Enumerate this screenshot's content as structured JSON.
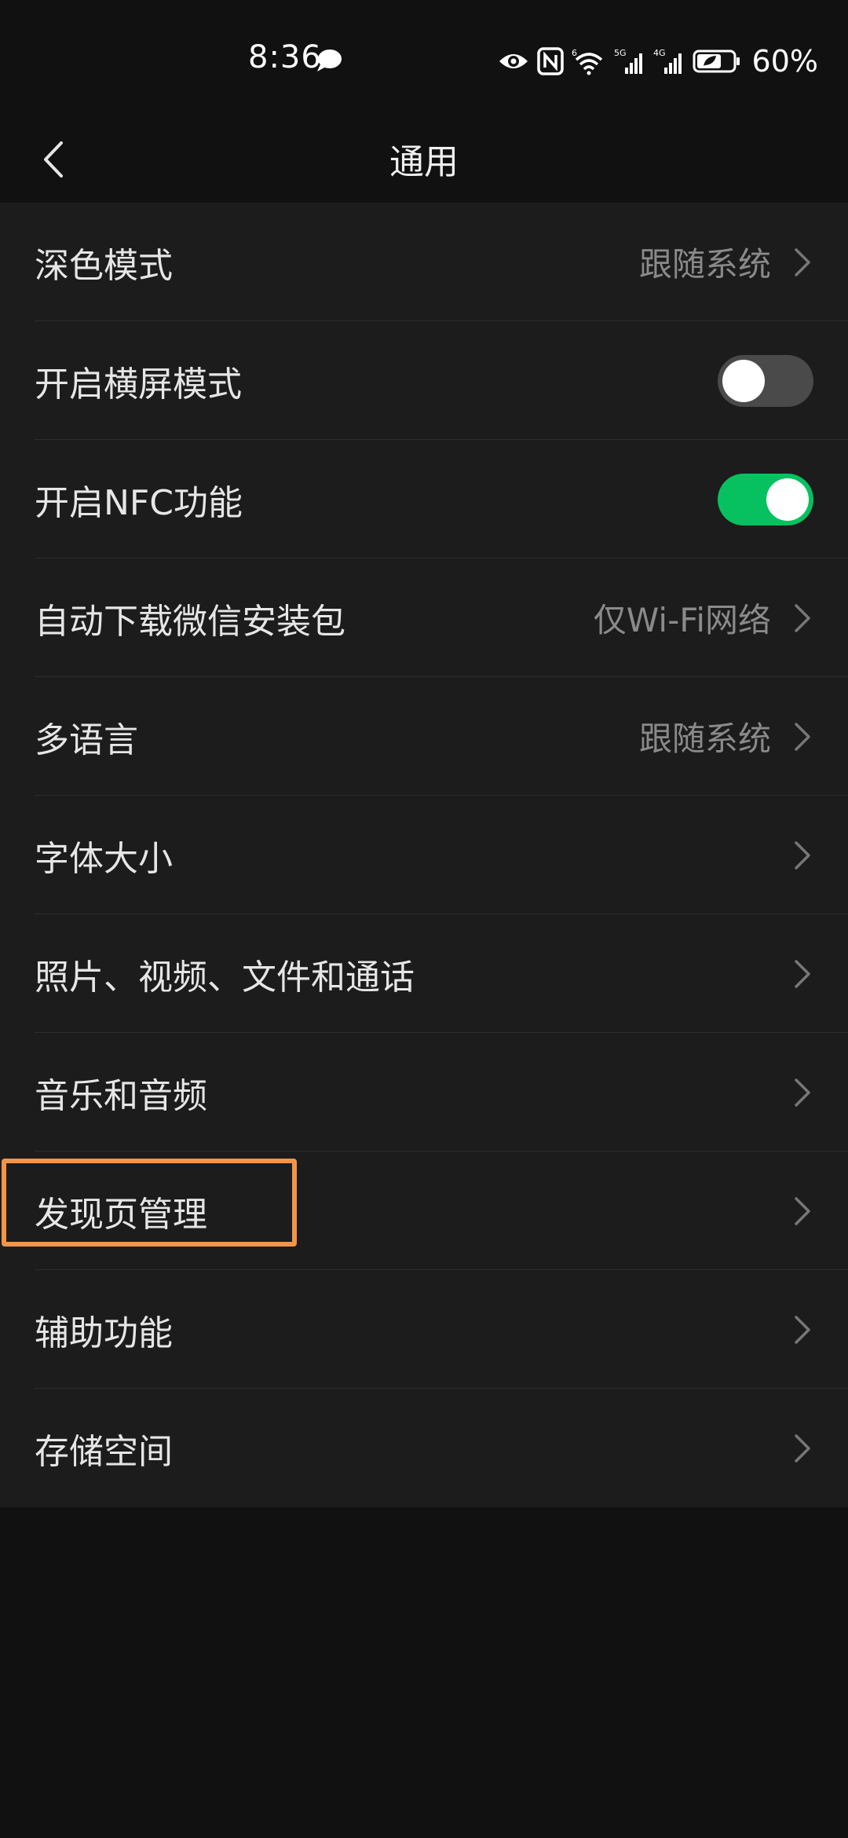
{
  "status_bar": {
    "time": "8:36",
    "battery": "60%",
    "icons": [
      "message-icon",
      "eye-icon",
      "nfc-icon",
      "wifi-6-icon",
      "signal-5g-icon",
      "signal-4g-icon",
      "battery-leaf-icon"
    ],
    "wifi_tag": "6",
    "sim1_tag": "5G",
    "sim2_tag": "4G"
  },
  "nav": {
    "title": "通用"
  },
  "colors": {
    "background": "#111111",
    "row_background": "#1c1c1c",
    "toggle_on": "#07c160",
    "toggle_off": "#4a4a4a",
    "highlight": "#f39548"
  },
  "settings": {
    "items": [
      {
        "label": "深色模式",
        "value": "跟随系统"
      },
      {
        "label": "开启横屏模式",
        "toggle": false
      },
      {
        "label": "开启NFC功能",
        "toggle": true
      },
      {
        "label": "自动下载微信安装包",
        "value": "仅Wi-Fi网络"
      },
      {
        "label": "多语言",
        "value": "跟随系统"
      },
      {
        "label": "字体大小"
      },
      {
        "label": "照片、视频、文件和通话"
      },
      {
        "label": "音乐和音频"
      },
      {
        "label": "发现页管理",
        "highlighted": true
      },
      {
        "label": "辅助功能"
      },
      {
        "label": "存储空间"
      }
    ]
  }
}
